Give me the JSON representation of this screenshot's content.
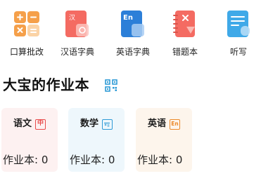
{
  "tools": [
    {
      "label": "口算批改",
      "icon": "calculator-icon"
    },
    {
      "label": "汉语字典",
      "icon": "chinese-dictionary-icon",
      "glyph": "汉"
    },
    {
      "label": "英语字典",
      "icon": "english-dictionary-icon",
      "glyph": "En"
    },
    {
      "label": "错题本",
      "icon": "mistake-notebook-icon"
    },
    {
      "label": "听写",
      "icon": "dictation-icon"
    }
  ],
  "section": {
    "title": "大宝的作业本",
    "qr_icon": "qr-code-icon"
  },
  "cards": [
    {
      "subject": "语文",
      "badge": "中",
      "count": "作业本: 0",
      "bg": "#fdf1f1",
      "color": "#e84b4b"
    },
    {
      "subject": "数学",
      "badge": "",
      "count": "作业本: 0",
      "bg": "#eef7fc",
      "color": "#2f9bd6"
    },
    {
      "subject": "英语",
      "badge": "En",
      "count": "作业本: 0",
      "bg": "#fdf5ec",
      "color": "#ec8a2a"
    }
  ]
}
